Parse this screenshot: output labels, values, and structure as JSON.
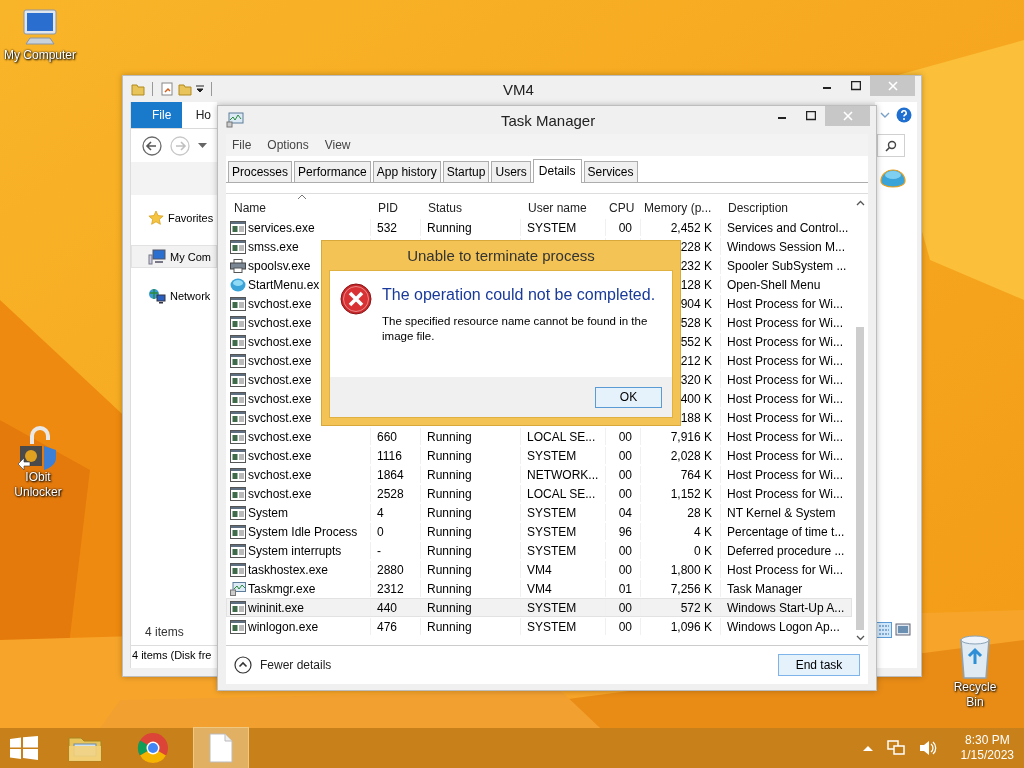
{
  "desktop_icons": [
    {
      "label": "My Computer",
      "kind": "computer"
    },
    {
      "label": "IObit Unlocker",
      "kind": "unlocker"
    },
    {
      "label": "Recycle Bin",
      "kind": "recycle"
    }
  ],
  "explorer": {
    "title": "VM4",
    "ribbon_tabs": [
      {
        "label": "File",
        "kind": "file"
      },
      {
        "label": "Ho",
        "kind": "tab"
      }
    ],
    "nav_items": [
      {
        "label": "Favorites",
        "kind": "star",
        "selected": false
      },
      {
        "label": "My Com",
        "kind": "computer",
        "selected": true
      },
      {
        "label": "Network",
        "kind": "network",
        "selected": false
      }
    ],
    "item_count": "4 items",
    "status_bar": "4 items (Disk fre"
  },
  "task_manager": {
    "title": "Task Manager",
    "menu": [
      "File",
      "Options",
      "View"
    ],
    "tabs": [
      {
        "label": "Processes",
        "selected": false
      },
      {
        "label": "Performance",
        "selected": false
      },
      {
        "label": "App history",
        "selected": false
      },
      {
        "label": "Startup",
        "selected": false
      },
      {
        "label": "Users",
        "selected": false
      },
      {
        "label": "Details",
        "selected": true
      },
      {
        "label": "Services",
        "selected": false
      }
    ],
    "columns": [
      {
        "label": "Name",
        "sorted": true
      },
      {
        "label": "PID",
        "sorted": false
      },
      {
        "label": "Status",
        "sorted": false
      },
      {
        "label": "User name",
        "sorted": false
      },
      {
        "label": "CPU",
        "sorted": false
      },
      {
        "label": "Memory (p...",
        "sorted": false
      },
      {
        "label": "Description",
        "sorted": false
      }
    ],
    "rows": [
      {
        "kind": "app",
        "name": "services.exe",
        "pid": "532",
        "status": "Running",
        "user": "SYSTEM",
        "cpu": "00",
        "memory": "2,452 K",
        "description": "Services and Control...",
        "selected": false
      },
      {
        "kind": "app",
        "name": "smss.exe",
        "memory": "228 K",
        "description": "Windows Session M...",
        "selected": false
      },
      {
        "kind": "printer",
        "name": "spoolsv.exe",
        "memory": "232 K",
        "description": "Spooler SubSystem ...",
        "selected": false
      },
      {
        "kind": "shell",
        "name": "StartMenu.ex",
        "memory": "128 K",
        "description": "Open-Shell Menu",
        "selected": false
      },
      {
        "kind": "app",
        "name": "svchost.exe",
        "memory": "904 K",
        "description": "Host Process for Wi...",
        "selected": false
      },
      {
        "kind": "app",
        "name": "svchost.exe",
        "memory": "528 K",
        "description": "Host Process for Wi...",
        "selected": false
      },
      {
        "kind": "app",
        "name": "svchost.exe",
        "memory": "552 K",
        "description": "Host Process for Wi...",
        "selected": false
      },
      {
        "kind": "app",
        "name": "svchost.exe",
        "memory": "212 K",
        "description": "Host Process for Wi...",
        "selected": false
      },
      {
        "kind": "app",
        "name": "svchost.exe",
        "memory": "320 K",
        "description": "Host Process for Wi...",
        "selected": false
      },
      {
        "kind": "app",
        "name": "svchost.exe",
        "memory": "400 K",
        "description": "Host Process for Wi...",
        "selected": false
      },
      {
        "kind": "app",
        "name": "svchost.exe",
        "memory": "188 K",
        "description": "Host Process for Wi...",
        "selected": false
      },
      {
        "kind": "app",
        "name": "svchost.exe",
        "pid": "660",
        "status": "Running",
        "user": "LOCAL SE...",
        "cpu": "00",
        "memory": "7,916 K",
        "description": "Host Process for Wi...",
        "selected": false
      },
      {
        "kind": "app",
        "name": "svchost.exe",
        "pid": "1116",
        "status": "Running",
        "user": "SYSTEM",
        "cpu": "00",
        "memory": "2,028 K",
        "description": "Host Process for Wi...",
        "selected": false
      },
      {
        "kind": "app",
        "name": "svchost.exe",
        "pid": "1864",
        "status": "Running",
        "user": "NETWORK...",
        "cpu": "00",
        "memory": "764 K",
        "description": "Host Process for Wi...",
        "selected": false
      },
      {
        "kind": "app",
        "name": "svchost.exe",
        "pid": "2528",
        "status": "Running",
        "user": "LOCAL SE...",
        "cpu": "00",
        "memory": "1,152 K",
        "description": "Host Process for Wi...",
        "selected": false
      },
      {
        "kind": "app",
        "name": "System",
        "pid": "4",
        "status": "Running",
        "user": "SYSTEM",
        "cpu": "04",
        "memory": "28 K",
        "description": "NT Kernel & System",
        "selected": false
      },
      {
        "kind": "app",
        "name": "System Idle Process",
        "pid": "0",
        "status": "Running",
        "user": "SYSTEM",
        "cpu": "96",
        "memory": "4 K",
        "description": "Percentage of time t...",
        "selected": false
      },
      {
        "kind": "app",
        "name": "System interrupts",
        "pid": "-",
        "status": "Running",
        "user": "SYSTEM",
        "cpu": "00",
        "memory": "0 K",
        "description": "Deferred procedure ...",
        "selected": false
      },
      {
        "kind": "app",
        "name": "taskhostex.exe",
        "pid": "2880",
        "status": "Running",
        "user": "VM4",
        "cpu": "00",
        "memory": "1,800 K",
        "description": "Host Process for Wi...",
        "selected": false
      },
      {
        "kind": "taskmgr",
        "name": "Taskmgr.exe",
        "pid": "2312",
        "status": "Running",
        "user": "VM4",
        "cpu": "01",
        "memory": "7,256 K",
        "description": "Task Manager",
        "selected": false
      },
      {
        "kind": "app",
        "name": "wininit.exe",
        "pid": "440",
        "status": "Running",
        "user": "SYSTEM",
        "cpu": "00",
        "memory": "572 K",
        "description": "Windows Start-Up A...",
        "selected": true
      },
      {
        "kind": "app",
        "name": "winlogon.exe",
        "pid": "476",
        "status": "Running",
        "user": "SYSTEM",
        "cpu": "00",
        "memory": "1,096 K",
        "description": "Windows Logon Ap...",
        "selected": false
      }
    ],
    "fewer_details": "Fewer details",
    "end_task": "End task"
  },
  "dialog": {
    "title": "Unable to terminate process",
    "heading": "The operation could not be completed.",
    "message": "The specified resource name cannot be found in the image file.",
    "button": "OK"
  },
  "taskbar": {
    "apps": [
      {
        "kind": "explorer",
        "active": false
      },
      {
        "kind": "chrome",
        "active": false
      },
      {
        "kind": "document",
        "active": true
      }
    ],
    "time": "8:30 PM",
    "date": "1/15/2023"
  }
}
